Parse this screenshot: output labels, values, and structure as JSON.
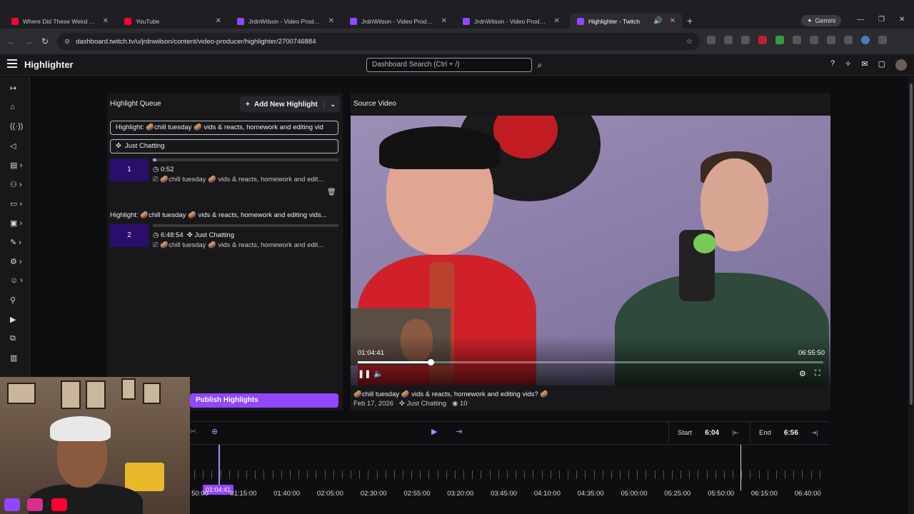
{
  "browser": {
    "tabs": [
      {
        "title": "Where Did These Weird 3D",
        "fav": "#ff0033"
      },
      {
        "title": "YouTube",
        "fav": "#ff0033"
      },
      {
        "title": "JrdnWilson - Video Produce",
        "fav": "#9147ff"
      },
      {
        "title": "JrdnWilson - Video Produce",
        "fav": "#9147ff"
      },
      {
        "title": "JrdnWilson - Video Produce",
        "fav": "#9147ff"
      },
      {
        "title": "Highlighter - Twitch",
        "fav": "#9147ff"
      }
    ],
    "gemini": "Gemini",
    "url": "dashboard.twitch.tv/u/jrdnwilson/content/video-producer/highlighter/2700746884"
  },
  "topnav": {
    "title": "Highlighter",
    "search_placeholder": "Dashboard Search (Ctrl + /)"
  },
  "queue": {
    "header": "Highlight Queue",
    "add_label": "Add New Highlight",
    "title_field": "Highlight: 🥔chill tuesday 🥔 vids & reacts, homework and editing vid",
    "category_field": "Just Chatting",
    "clips": [
      {
        "number": "1",
        "duration": "0:52",
        "category": "",
        "title": "🥔chill tuesday 🥔 vids & reacts, homework and edit...",
        "progress": 0.02
      },
      {
        "number": "2",
        "duration": "6:48:54",
        "category": "Just Chatting",
        "title": "🥔chill tuesday 🥔 vids & reacts, homework and edit...",
        "progress": 0.0
      }
    ],
    "highlight2_title": "Highlight: 🥔chill tuesday 🥔 vids & reacts, homework and editing vids...",
    "publish_label": "Publish Highlights"
  },
  "video": {
    "header": "Source Video",
    "current_time": "01:04:41",
    "duration": "06:55:50",
    "progress": 0.156,
    "title": "🥔chill tuesday 🥔 vids & reacts, homework and editing vids? 🥔",
    "date": "Feb 17, 2026",
    "category": "Just Chatting",
    "views": "10"
  },
  "timeline": {
    "start_label": "Start",
    "start_value": "6:04",
    "end_label": "End",
    "end_value": "6:56",
    "playhead_label": "01:04:41",
    "ticks": [
      "50:00",
      "01:15:00",
      "01:40:00",
      "02:05:00",
      "02:30:00",
      "02:55:00",
      "03:20:00",
      "03:45:00",
      "04:10:00",
      "04:35:00",
      "05:00:00",
      "05:25:00",
      "05:50:00",
      "06:15:00",
      "06:40:00"
    ]
  },
  "colors": {
    "accent": "#9147ff",
    "accent_light": "#b28bff",
    "clip_bg": "#2c0d6b"
  }
}
